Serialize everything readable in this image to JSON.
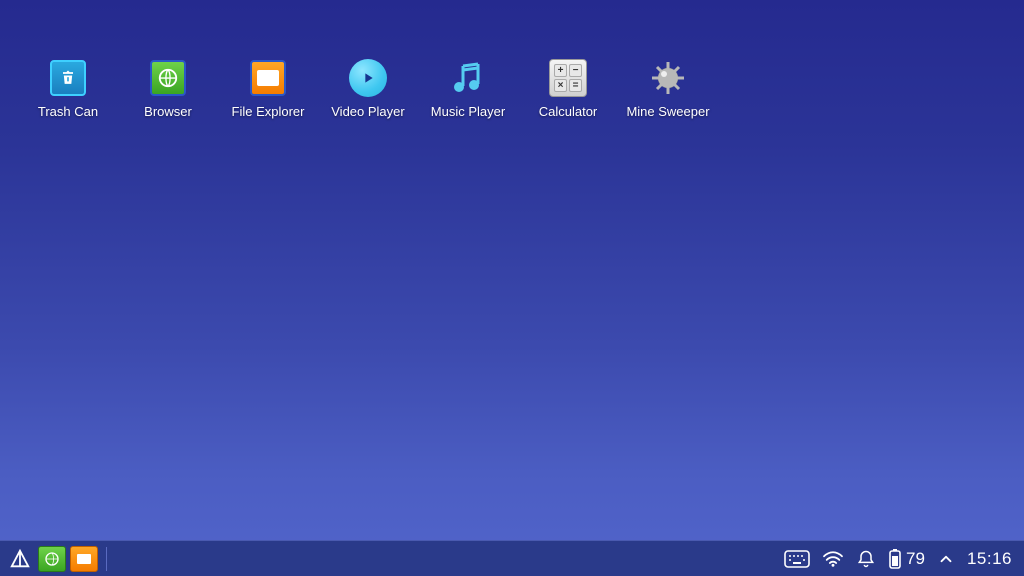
{
  "desktop": {
    "icons": [
      {
        "id": "trash-can",
        "label": "Trash Can"
      },
      {
        "id": "browser",
        "label": "Browser"
      },
      {
        "id": "file-explorer",
        "label": "File Explorer"
      },
      {
        "id": "video-player",
        "label": "Video Player"
      },
      {
        "id": "music-player",
        "label": "Music Player"
      },
      {
        "id": "calculator",
        "label": "Calculator"
      },
      {
        "id": "mine-sweeper",
        "label": "Mine Sweeper"
      }
    ]
  },
  "taskbar": {
    "battery_percent": "79",
    "clock": "15:16"
  }
}
